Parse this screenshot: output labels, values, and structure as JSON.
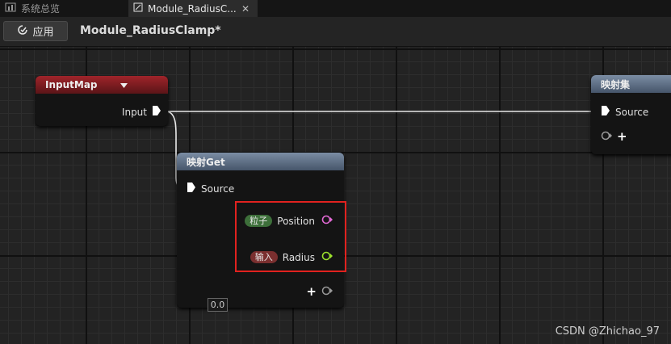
{
  "tabs": [
    {
      "label": "系统总览",
      "icon": "chart-icon",
      "active": false
    },
    {
      "label": "Module_RadiusC...",
      "icon": "module-icon",
      "active": true
    }
  ],
  "toolbar": {
    "apply_label": "应用",
    "asset_title": "Module_RadiusClamp*"
  },
  "nodes": {
    "input_map": {
      "title": "InputMap",
      "output_pin": "Input",
      "color": "#9a2226"
    },
    "map_get": {
      "title": "映射Get",
      "source_pin": "Source",
      "outputs": [
        {
          "badge": "粒子",
          "label": "Position",
          "badge_color": "#3d6f3a",
          "pin_color": "#e36ad6"
        },
        {
          "badge": "输入",
          "label": "Radius",
          "badge_color": "#7a2f2f",
          "pin_color": "#9be02c",
          "default_value": "0.0"
        }
      ],
      "add_label": "+",
      "color": "#6f8197"
    },
    "map_set": {
      "title": "映射集",
      "source_pin": "Source",
      "add_label": "+",
      "color": "#6f8197"
    }
  },
  "watermark": "CSDN @Zhichao_97"
}
